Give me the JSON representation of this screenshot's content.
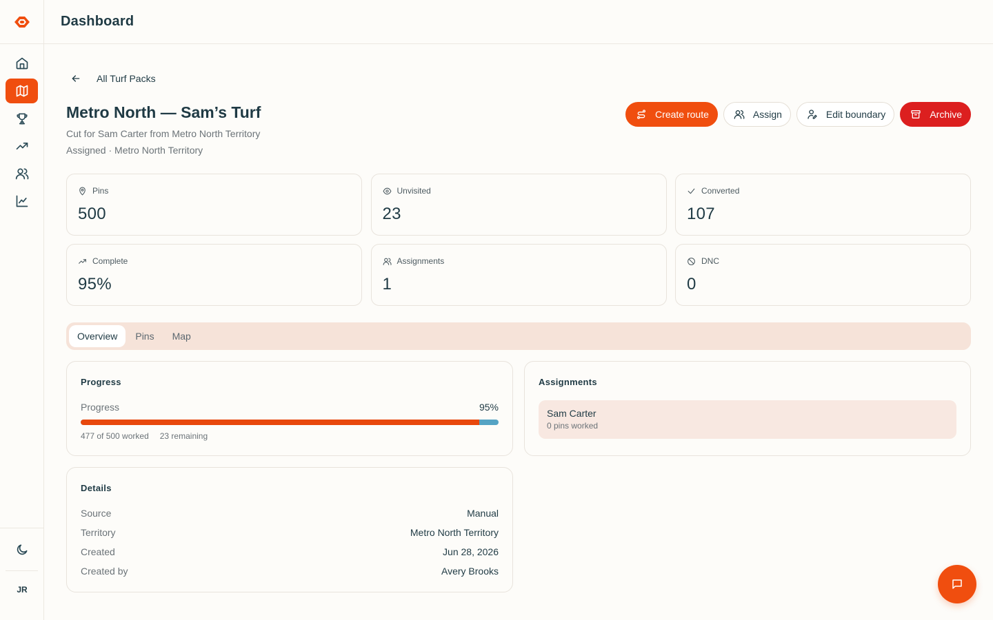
{
  "header": {
    "title": "Dashboard"
  },
  "sidebar": {
    "items": [
      {
        "icon": "home-icon",
        "active": false
      },
      {
        "icon": "map-icon",
        "active": true
      },
      {
        "icon": "trophy-icon",
        "active": false
      },
      {
        "icon": "trending-up-icon",
        "active": false
      },
      {
        "icon": "users-icon",
        "active": false
      },
      {
        "icon": "chart-line-icon",
        "active": false
      }
    ],
    "theme_icon": "moon-icon",
    "avatar_initials": "JR"
  },
  "page": {
    "back_label": "All Turf Packs",
    "title": "Metro North — Sam’s Turf",
    "subtitle": "Cut for Sam Carter from Metro North Territory",
    "meta": "Assigned · Metro North Territory"
  },
  "actions": {
    "create_route": "Create route",
    "assign": "Assign",
    "edit_boundary": "Edit boundary",
    "archive": "Archive"
  },
  "stats": [
    {
      "label": "Pins",
      "value": "500",
      "icon": "map-pin-icon"
    },
    {
      "label": "Unvisited",
      "value": "23",
      "icon": "eye-icon"
    },
    {
      "label": "Converted",
      "value": "107",
      "icon": "check-icon"
    },
    {
      "label": "Complete",
      "value": "95%",
      "icon": "trending-up-icon"
    },
    {
      "label": "Assignments",
      "value": "1",
      "icon": "users-icon"
    },
    {
      "label": "DNC",
      "value": "0",
      "icon": "ban-icon"
    }
  ],
  "tabs": [
    {
      "label": "Overview",
      "active": true
    },
    {
      "label": "Pins",
      "active": false
    },
    {
      "label": "Map",
      "active": false
    }
  ],
  "progress": {
    "heading": "Progress",
    "label": "Progress",
    "percent_text": "95%",
    "fraction": 0.954,
    "worked_text": "477 of 500 worked",
    "remaining_text": "23 remaining"
  },
  "assignments": {
    "heading": "Assignments",
    "items": [
      {
        "name": "Sam Carter",
        "sub": "0 pins worked"
      }
    ]
  },
  "details": {
    "heading": "Details",
    "rows": [
      {
        "key": "Source",
        "value": "Manual"
      },
      {
        "key": "Territory",
        "value": "Metro North Territory"
      },
      {
        "key": "Created",
        "value": "Jun 28, 2026"
      },
      {
        "key": "Created by",
        "value": "Avery Brooks"
      }
    ]
  },
  "colors": {
    "accent": "#f04e0f",
    "danger": "#dc1f1f",
    "progress_fill": "#e8480d",
    "progress_rest": "#55a3c4",
    "tabs_bg": "#f6e3d9"
  }
}
